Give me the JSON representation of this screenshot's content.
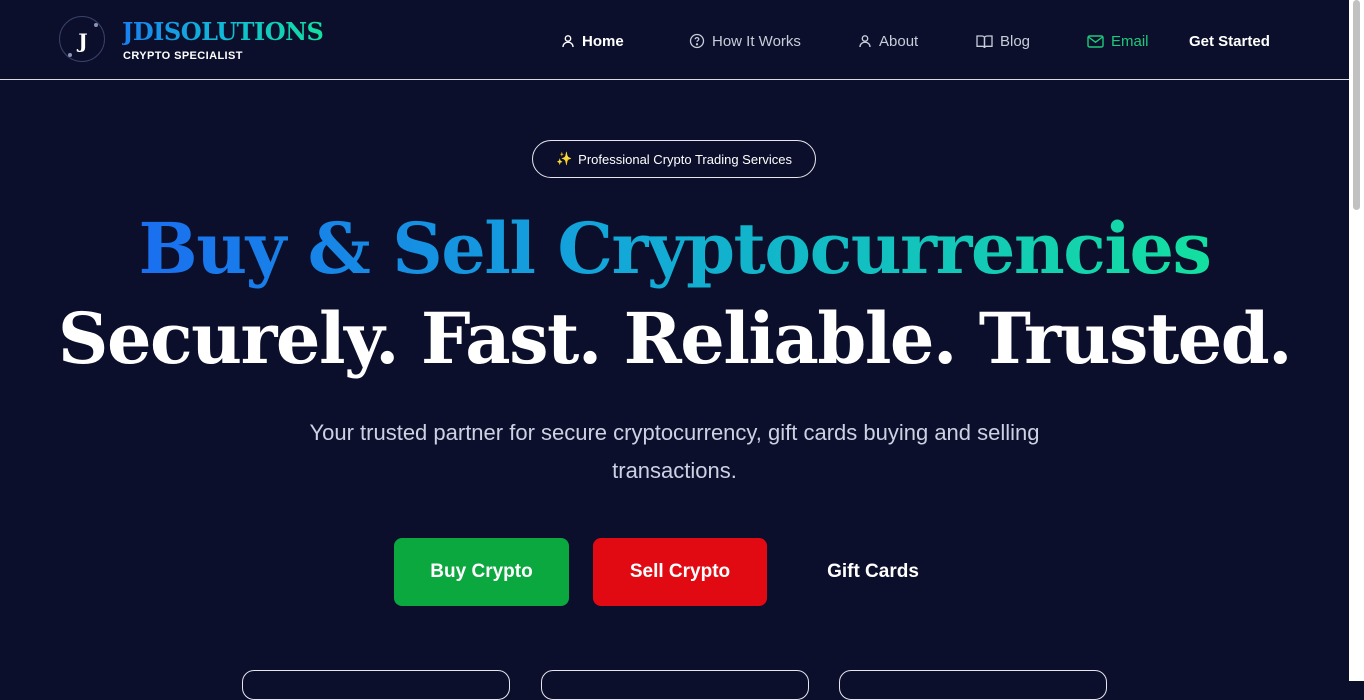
{
  "header": {
    "logo_letter": "J",
    "brand": "JDISOLUTIONS",
    "tagline": "CRYPTO SPECIALIST",
    "nav": [
      {
        "label": "Home",
        "icon": "user-icon"
      },
      {
        "label": "How It Works",
        "icon": "question-circle-icon"
      },
      {
        "label": "About",
        "icon": "user-icon"
      },
      {
        "label": "Blog",
        "icon": "book-icon"
      },
      {
        "label": "Email",
        "icon": "mail-icon"
      },
      {
        "label": "Get Started"
      }
    ]
  },
  "hero": {
    "badge_icon": "sparkles-icon",
    "badge": "Professional Crypto Trading Services",
    "headline_line1": "Buy & Sell Cryptocurrencies",
    "headline_line2": "Securely. Fast. Reliable. Trusted.",
    "subtitle": "Your trusted partner for secure cryptocurrency, gift cards buying and selling transactions.",
    "buttons": {
      "buy": "Buy Crypto",
      "sell": "Sell Crypto",
      "gift": "Gift Cards"
    }
  },
  "colors": {
    "background": "#0b0f2b",
    "accent_blue": "#1a6ff0",
    "accent_green": "#13e0a0",
    "buy_button": "#0aa83f",
    "sell_button": "#e20a12",
    "email_link": "#1ec97a"
  }
}
